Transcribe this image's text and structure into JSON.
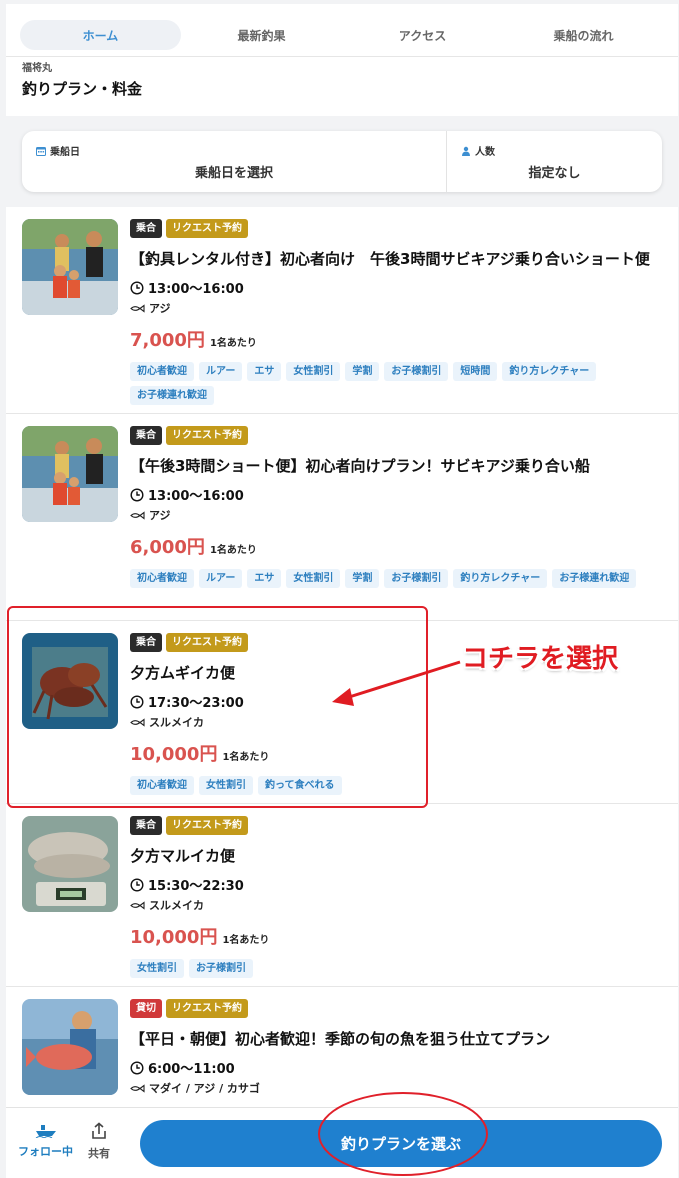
{
  "tabs": [
    "ホーム",
    "最新釣果",
    "アクセス",
    "乗船の流れ"
  ],
  "boat_name": "福将丸",
  "page_title": "釣りプラン・料金",
  "filter": {
    "date_label": "乗船日",
    "date_value": "乗船日を選択",
    "people_label": "人数",
    "people_value": "指定なし"
  },
  "per_person": "1名あたり",
  "plans": [
    {
      "type": "乗合",
      "request": "リクエスト予約",
      "title": "【釣具レンタル付き】初心者向け　午後3時間サビキアジ乗り合いショート便",
      "time": "13:00〜16:00",
      "fish": "アジ",
      "price": "7,000円",
      "tags": [
        "初心者歓迎",
        "ルアー",
        "エサ",
        "女性割引",
        "学割",
        "お子様割引",
        "短時間",
        "釣り方レクチャー",
        "お子様連れ歓迎"
      ]
    },
    {
      "type": "乗合",
      "request": "リクエスト予約",
      "title": "【午後3時間ショート便】初心者向けプラン！サビキアジ乗り合い船",
      "time": "13:00〜16:00",
      "fish": "アジ",
      "price": "6,000円",
      "tags": [
        "初心者歓迎",
        "ルアー",
        "エサ",
        "女性割引",
        "学割",
        "お子様割引",
        "釣り方レクチャー",
        "お子様連れ歓迎"
      ]
    },
    {
      "type": "乗合",
      "request": "リクエスト予約",
      "title": "夕方ムギイカ便",
      "time": "17:30〜23:00",
      "fish": "スルメイカ",
      "price": "10,000円",
      "tags": [
        "初心者歓迎",
        "女性割引",
        "釣って食べれる"
      ]
    },
    {
      "type": "乗合",
      "request": "リクエスト予約",
      "title": "夕方マルイカ便",
      "time": "15:30〜22:30",
      "fish": "スルメイカ",
      "price": "10,000円",
      "tags": [
        "女性割引",
        "お子様割引"
      ]
    },
    {
      "type": "貸切",
      "request": "リクエスト予約",
      "title": "【平日・朝便】初心者歓迎！季節の旬の魚を狙う仕立てプラン",
      "time": "6:00〜11:00",
      "fish": "マダイ / アジ / カサゴ",
      "price": "",
      "tags": []
    }
  ],
  "annotation": {
    "callout": "コチラを選択",
    "color": "#e0202a"
  },
  "bottom": {
    "follow_label": "フォロー中",
    "share_label": "共有",
    "cta_label": "釣りプランを選ぶ"
  },
  "colors": {
    "accent": "#1f80cf",
    "price": "#d9534f",
    "request_badge": "#c39a1b",
    "charter_badge": "#d0393a"
  }
}
